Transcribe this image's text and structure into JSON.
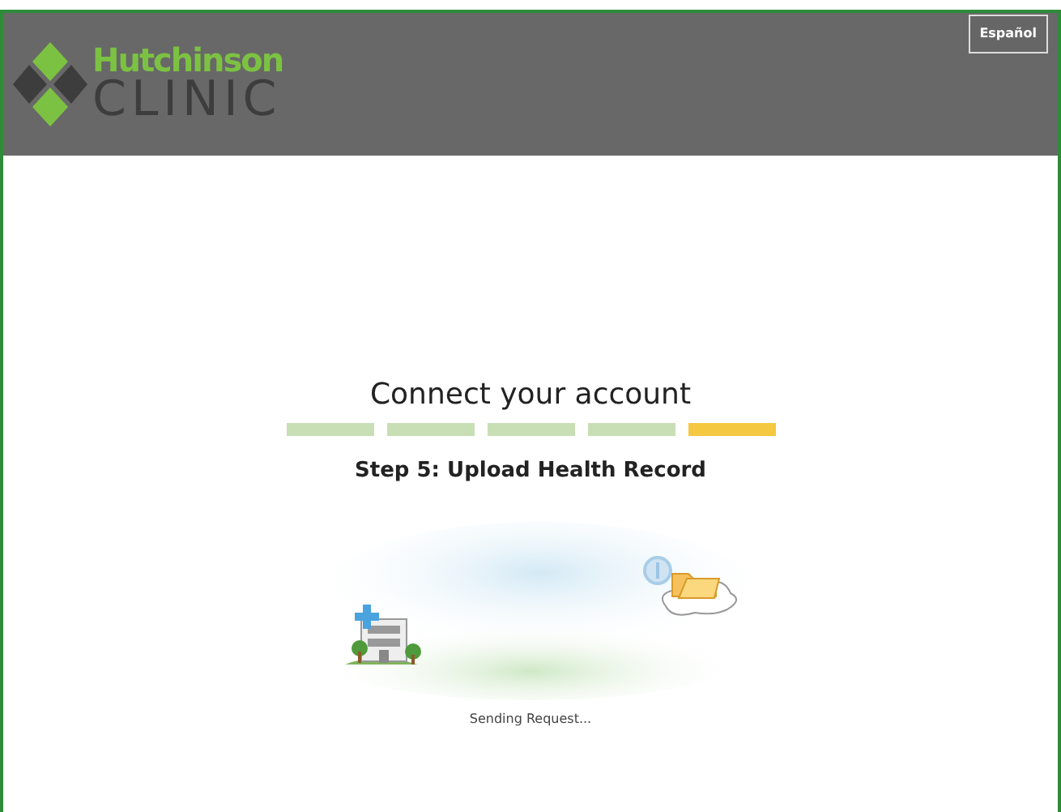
{
  "header": {
    "logo_line1": "Hutchinson",
    "logo_line2": "CLINIC",
    "language_button": "Español"
  },
  "title": "Connect your account",
  "steps": [
    {
      "selected": false
    },
    {
      "selected": false
    },
    {
      "selected": false
    },
    {
      "selected": false
    },
    {
      "selected": true
    }
  ],
  "step_label": "Step 5: Upload Health Record",
  "status_text": "Sending Request..."
}
